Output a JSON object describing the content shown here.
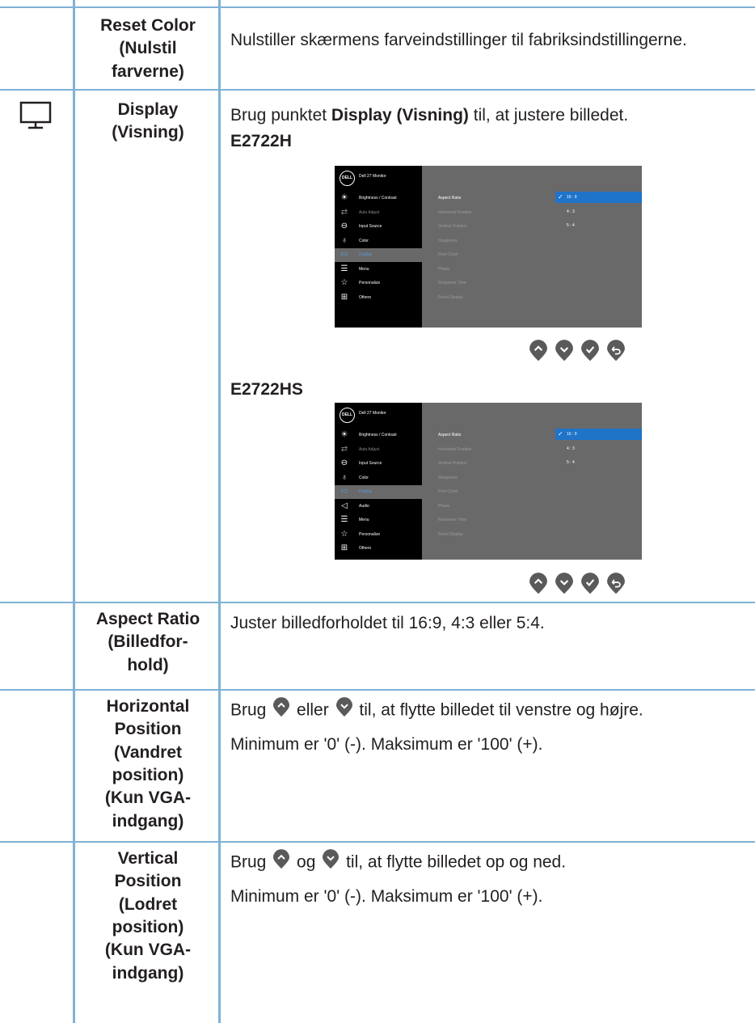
{
  "rows": {
    "reset_color": {
      "label": "Reset Color\n(Nulstil\nfarverne)",
      "desc": "Nulstiller skærmens farveindstillinger til fabriksindstillingerne."
    },
    "display": {
      "label": "Display\n(Visning)",
      "desc_pre": "Brug punktet ",
      "desc_bold": "Display (Visning)",
      "desc_post": " til, at justere billedet.",
      "model1": "E2722H",
      "model2": "E2722HS",
      "icon": "monitor-icon"
    },
    "aspect_ratio": {
      "label": "Aspect Ratio\n(Billedfor-\nhold)",
      "desc": "Juster billedforholdet til 16:9, 4:3 eller 5:4."
    },
    "horizontal": {
      "label": "Horizontal\nPosition\n(Vandret\nposition)\n(Kun VGA-\nindgang)",
      "l1a": "Brug ",
      "l1b": " eller ",
      "l1c": "  til, at flytte billedet til venstre og højre.",
      "l2": "Minimum er '0' (-). Maksimum er '100' (+)."
    },
    "vertical": {
      "label": "Vertical\nPosition\n(Lodret\nposition)\n(Kun VGA-\nindgang)",
      "l1a": "Brug ",
      "l1b": " og ",
      "l1c": " til, at flytte billedet op og ned.",
      "l2": "Minimum er '0' (-). Maksimum er '100' (+)."
    }
  },
  "osd": {
    "brand": "DELL",
    "title": "Dell 27 Monitor",
    "menu_h": [
      "Brightness / Contrast",
      "Auto Adjust",
      "Input Source",
      "Color",
      "Display",
      "Menu",
      "Personalize",
      "Others"
    ],
    "menu_hs": [
      "Brightness / Contrast",
      "Auto Adjust",
      "Input Source",
      "Color",
      "Display",
      "Audio",
      "Menu",
      "Personalize",
      "Others"
    ],
    "submenu": [
      "Aspect Ratio",
      "Horizontal Position",
      "Vertical Position",
      "Sharpness",
      "Pixel Clock",
      "Phase",
      "Response Time",
      "Reset Display"
    ],
    "options": [
      "16 : 9",
      "4 : 3",
      "5 : 4"
    ]
  },
  "colors": {
    "rule": "#7fb2d6",
    "accent": "#1f73c9",
    "button": "#5a5a5a"
  }
}
